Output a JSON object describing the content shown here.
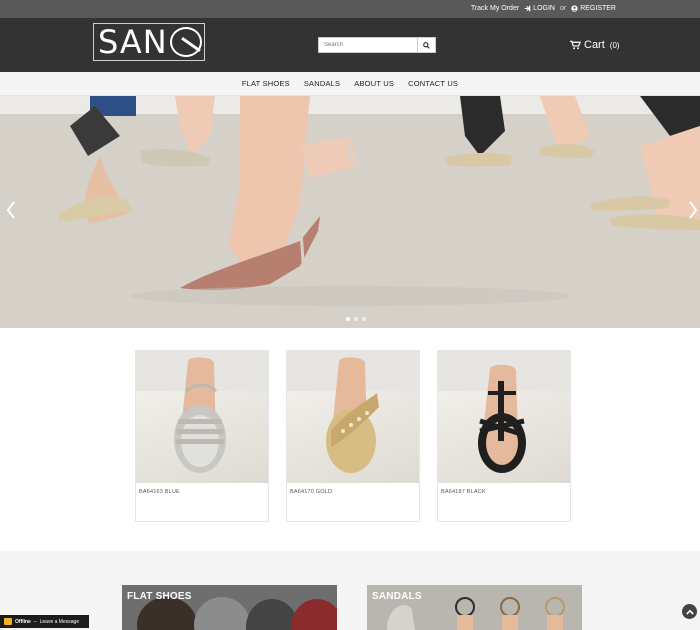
{
  "topbar": {
    "track_order": "Track My Order",
    "login": "LOGIN",
    "or": "or",
    "register": "REGISTER"
  },
  "header": {
    "logo_text": "SAN",
    "search_placeholder": "Search",
    "cart_label": "Cart",
    "cart_count": "(0)"
  },
  "nav": {
    "items": [
      "FLAT SHOES",
      "SANDALS",
      "ABOUT US",
      "CONTACT US"
    ]
  },
  "hero": {
    "prev_icon": "chevron-left-icon",
    "next_icon": "chevron-right-icon",
    "slide_count": 3,
    "active_slide": 1
  },
  "products": [
    {
      "name": "BA64163 BLUE",
      "color": "#c9c7c1"
    },
    {
      "name": "BA64170 GOLD",
      "color": "#c8a86c"
    },
    {
      "name": "BA64187 BLACK",
      "color": "#1f1f1f"
    }
  ],
  "categories": [
    {
      "label": "FLAT SHOES"
    },
    {
      "label": "SANDALS"
    }
  ],
  "chat": {
    "status": "Offline",
    "message": "Leave a Message"
  },
  "colors": {
    "header_bg": "#333333",
    "topbar_bg": "#595959",
    "nav_bg": "#f5f5f5"
  }
}
